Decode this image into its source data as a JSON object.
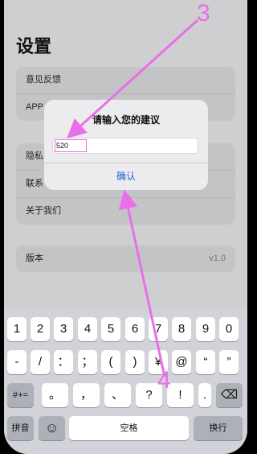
{
  "page": {
    "title": "设置"
  },
  "settings": {
    "group1": [
      {
        "label": "意见反馈"
      },
      {
        "label": "APP"
      }
    ],
    "group2": [
      {
        "label": "隐私"
      },
      {
        "label": "联系"
      },
      {
        "label": "关于我们"
      }
    ],
    "group3": [
      {
        "label": "版本",
        "value": "v1.0"
      }
    ]
  },
  "dialog": {
    "title": "请输入您的建议",
    "input_value": "520",
    "confirm_label": "确认"
  },
  "keyboard": {
    "row1": [
      "1",
      "2",
      "3",
      "4",
      "5",
      "6",
      "7",
      "8",
      "9",
      "0"
    ],
    "row2": [
      "-",
      "/",
      "：",
      "；",
      "(",
      ")",
      "¥",
      "@",
      "“",
      "”"
    ],
    "row3_left": "#+=",
    "row3": [
      "。",
      "，",
      "、",
      "?",
      "!",
      "."
    ],
    "row3_right": "⌫",
    "pinyin": "拼音",
    "emoji": "☺",
    "space": "空格",
    "return": "换行"
  },
  "annotations": {
    "label3": "3",
    "label4": "4"
  },
  "colors": {
    "annotation": "#e86fe8",
    "link": "#1f5fc8"
  }
}
